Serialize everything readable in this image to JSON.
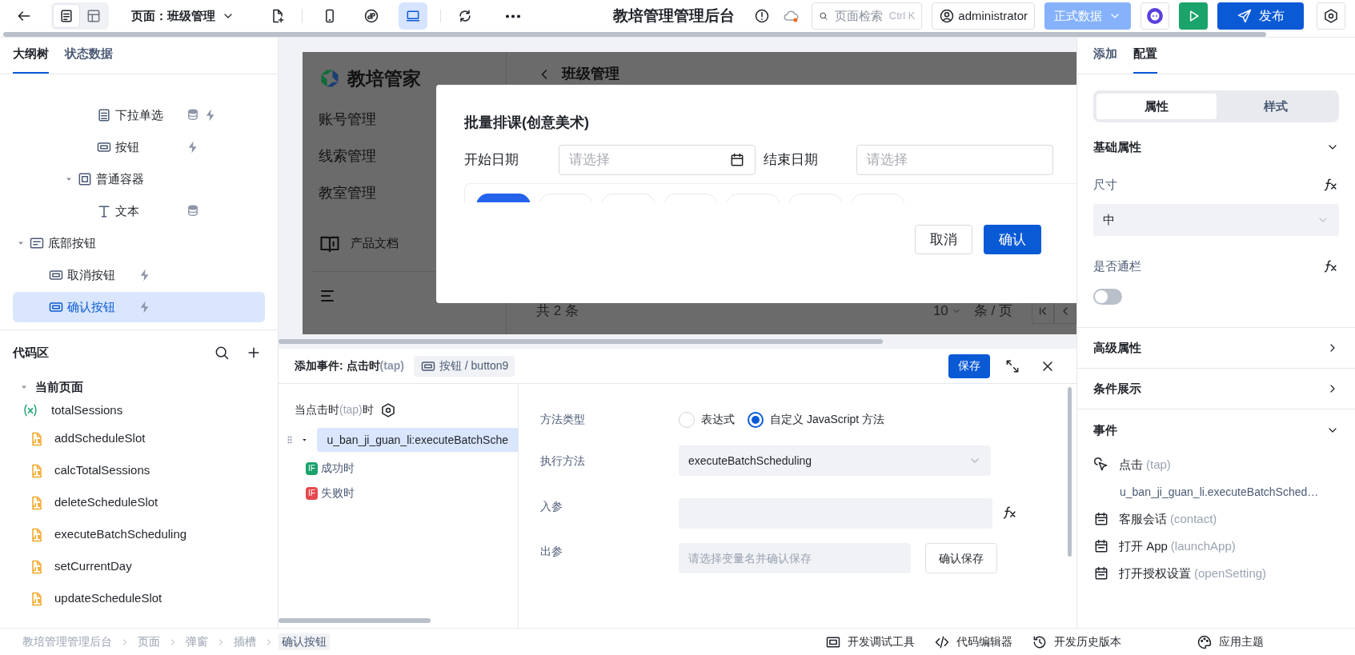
{
  "toolbar": {
    "view_modes": [
      {
        "kind": "outline",
        "selected": true
      },
      {
        "kind": "layout",
        "selected": false
      }
    ],
    "page_selector": "页面：班级管理",
    "devices": [
      {
        "kind": "mobile",
        "selected": false
      },
      {
        "kind": "miniprogram",
        "selected": false
      },
      {
        "kind": "desktop",
        "selected": true
      }
    ],
    "app_title": "教培管理管理后台",
    "search": {
      "placeholder": "页面检索",
      "shortcut": "Ctrl K"
    },
    "user": "administrator",
    "data_env": "正式数据",
    "publish": "发布"
  },
  "left_tabs": [
    {
      "label": "大纲树",
      "selected": true
    },
    {
      "label": "状态数据",
      "selected": false
    }
  ],
  "outline": [
    {
      "children": [
        {
          "children": [
            {
              "children": [
                {
                  "children": [
                    {
                      "label": "下拉单选",
                      "kind": "select",
                      "has_data": true,
                      "has_event": true,
                      "selected": false
                    },
                    {
                      "label": "按钮",
                      "kind": "button",
                      "has_data": false,
                      "has_event": true,
                      "selected": false
                    }
                  ]
                },
                {
                  "label": "普通容器",
                  "kind": "container",
                  "expanded": true,
                  "selected": false,
                  "children": [
                    {
                      "label": "文本",
                      "kind": "text",
                      "has_data": true,
                      "has_event": false,
                      "selected": false
                    }
                  ]
                }
              ]
            }
          ]
        }
      ]
    },
    {
      "label": "底部按钮",
      "kind": "footer",
      "expanded": true,
      "selected": false,
      "children": [
        {
          "label": "取消按钮",
          "kind": "button",
          "has_data": false,
          "has_event": true,
          "selected": false
        },
        {
          "label": "确认按钮",
          "kind": "button",
          "has_data": false,
          "has_event": true,
          "selected": true
        }
      ]
    }
  ],
  "code_area": {
    "title": "代码区",
    "group": {
      "label": "当前页面",
      "expanded": true,
      "items": [
        {
          "kind": "variable",
          "label": "totalSessions"
        },
        {
          "kind": "js",
          "label": "addScheduleSlot"
        },
        {
          "kind": "js",
          "label": "calcTotalSessions"
        },
        {
          "kind": "js",
          "label": "deleteScheduleSlot"
        },
        {
          "kind": "js",
          "label": "executeBatchScheduling"
        },
        {
          "kind": "js",
          "label": "setCurrentDay"
        },
        {
          "kind": "js",
          "label": "updateScheduleSlot"
        }
      ]
    }
  },
  "preview": {
    "logo": "教培管家",
    "nav": [
      "账号管理",
      "线索管理",
      "教室管理"
    ],
    "docs": "产品文档",
    "page_title": "班级管理",
    "total": "共 2 条",
    "page_size": "10",
    "per_page": "条 / 页",
    "dialog": {
      "title": "批量排课(创意美术)",
      "fields": [
        {
          "label": "开始日期",
          "placeholder": "请选择"
        },
        {
          "label": "结束日期",
          "placeholder": "请选择"
        }
      ],
      "day_tabs": [
        {
          "selected": true
        },
        {
          "selected": false
        },
        {
          "selected": false
        },
        {
          "selected": false
        },
        {
          "selected": false
        },
        {
          "selected": false
        },
        {
          "selected": false
        }
      ],
      "cancel": "取消",
      "confirm": "确认"
    }
  },
  "event_panel": {
    "title": "添加事件: 点击时",
    "title_event": "(tap)",
    "component_tag": "按钮 / button9",
    "save": "保存",
    "trigger": {
      "prefix": "当点击时",
      "event": "(tap)",
      "suffix": "时"
    },
    "action": {
      "label": "u_ban_ji_guan_li:executeBatchSche",
      "expanded": true,
      "selected": true
    },
    "branches": [
      {
        "badge": "IF",
        "label": "成功时",
        "color": "#1aa36b"
      },
      {
        "badge": "IF",
        "label": "失败时",
        "color": "#e5484d"
      }
    ],
    "method_type": {
      "label": "方法类型",
      "options": [
        {
          "label": "表达式",
          "selected": false
        },
        {
          "label": "自定义 JavaScript 方法",
          "selected": true
        }
      ]
    },
    "method": {
      "label": "执行方法",
      "value": "executeBatchScheduling"
    },
    "input": {
      "label": "入参"
    },
    "output": {
      "label": "出参",
      "placeholder": "请选择变量名并确认保存",
      "button": "确认保存"
    }
  },
  "right_tabs": [
    {
      "label": "添加",
      "selected": false
    },
    {
      "label": "配置",
      "selected": true
    }
  ],
  "segments": [
    {
      "label": "属性",
      "selected": true
    },
    {
      "label": "样式",
      "selected": false
    }
  ],
  "basic": {
    "title": "基础属性",
    "expanded": true,
    "size": {
      "label": "尺寸",
      "value": "中"
    },
    "full_width": {
      "label": "是否通栏",
      "on": false
    }
  },
  "sections": [
    {
      "title": "高级属性",
      "expanded": false
    },
    {
      "title": "条件展示",
      "expanded": false
    }
  ],
  "events": {
    "title": "事件",
    "expanded": true,
    "items": [
      {
        "kind": "tap",
        "label": "点击",
        "code": "(tap)",
        "handler": "u_ban_ji_guan_li.executeBatchSched…"
      },
      {
        "kind": "system",
        "label": "客服会话",
        "code": "(contact)"
      },
      {
        "kind": "system",
        "label": "打开 App",
        "code": "(launchApp)"
      },
      {
        "kind": "system",
        "label": "打开授权设置",
        "code": "(openSetting)"
      }
    ]
  },
  "theme_button": "应用主题",
  "breadcrumbs": [
    {
      "label": "教培管理管理后台",
      "selected": false
    },
    {
      "label": "页面",
      "selected": false
    },
    {
      "label": "弹窗",
      "selected": false
    },
    {
      "label": "插槽",
      "selected": false
    },
    {
      "label": "确认按钮",
      "selected": true
    }
  ],
  "bottom_tools": [
    {
      "kind": "debug",
      "label": "开发调试工具"
    },
    {
      "kind": "code",
      "label": "代码编辑器"
    },
    {
      "kind": "history",
      "label": "开发历史版本"
    }
  ]
}
